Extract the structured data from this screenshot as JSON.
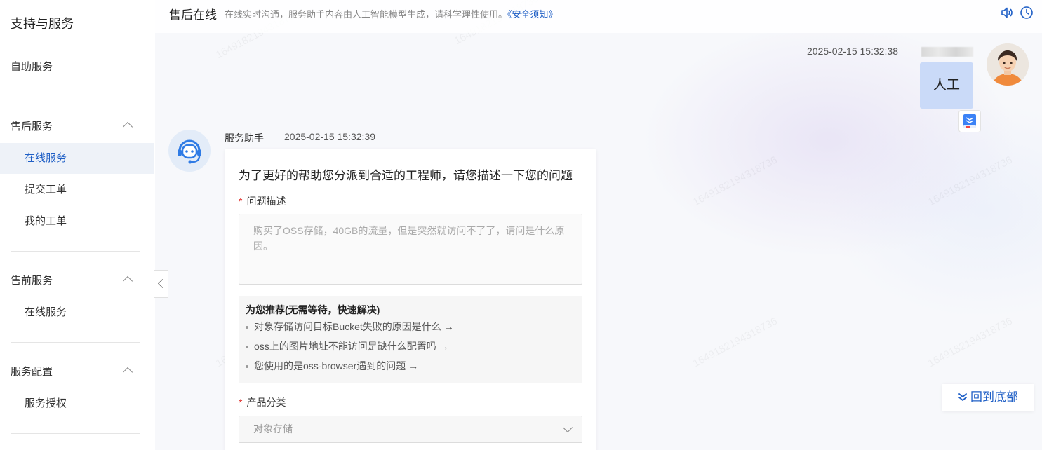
{
  "sidebar": {
    "title": "支持与服务",
    "self_service": "自助服务",
    "after_sales": {
      "label": "售后服务",
      "items": [
        "在线服务",
        "提交工单",
        "我的工单"
      ]
    },
    "pre_sales": {
      "label": "售前服务",
      "items": [
        "在线服务"
      ]
    },
    "config": {
      "label": "服务配置",
      "items": [
        "服务授权"
      ]
    }
  },
  "header": {
    "title": "售后在线",
    "subtitle": "在线实时沟通，服务助手内容由人工智能模型生成，请科学理性使用。",
    "link": "《安全须知》"
  },
  "user_message": {
    "time": "2025-02-15 15:32:38",
    "text": "人工"
  },
  "bot_message": {
    "name": "服务助手",
    "time": "2025-02-15 15:32:39",
    "form_title": "为了更好的帮助您分派到合适的工程师，请您描述一下您的问题",
    "problem_label": "问题描述",
    "problem_placeholder": "购买了OSS存储，40GB的流量，但是突然就访问不了了，请问是什么原因。",
    "reco_title": "为您推荐(无需等待，快速解决)",
    "reco_items": [
      "对象存储访问目标Bucket失败的原因是什么 →",
      "oss上的图片地址不能访问是缺什么配置吗 →",
      "您使用的是oss-browser遇到的问题 →"
    ],
    "category_label": "产品分类",
    "category_value": "对象存储"
  },
  "back_to_bottom": "回到底部",
  "watermark": "1649182194318736",
  "colors": {
    "accent": "#1f5fc6",
    "user_bubble": "#cadaf8",
    "active_bg": "#eef2f8"
  }
}
